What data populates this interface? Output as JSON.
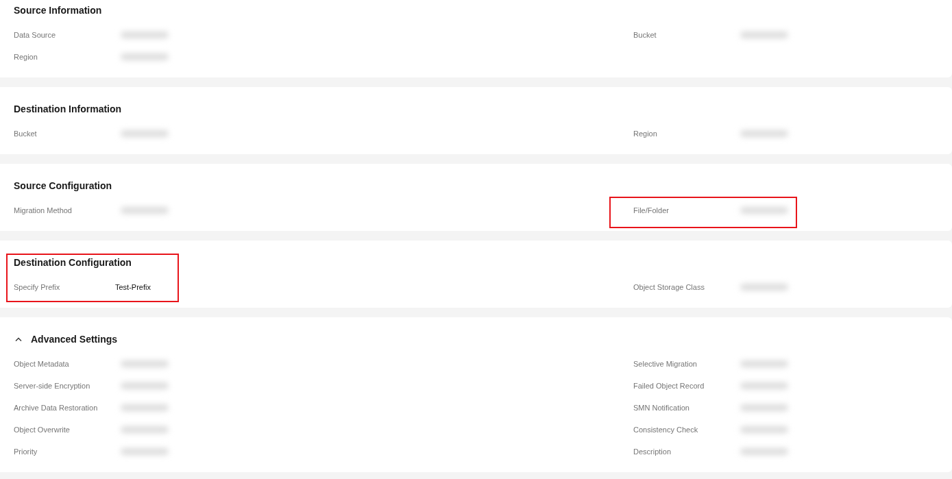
{
  "sections": [
    {
      "title": "Source Information",
      "rows": [
        [
          {
            "label": "Data Source"
          },
          {
            "label": "Bucket"
          }
        ],
        [
          {
            "label": "Region"
          }
        ]
      ]
    },
    {
      "title": "Destination Information",
      "rows": [
        [
          {
            "label": "Bucket"
          },
          {
            "label": "Region"
          }
        ]
      ]
    },
    {
      "title": "Source Configuration",
      "rows": [
        [
          {
            "label": "Migration Method"
          },
          {
            "label": "File/Folder",
            "highlighted": true
          }
        ]
      ]
    },
    {
      "title": "Destination Configuration",
      "highlighted": true,
      "rows": [
        [
          {
            "label": "Specify Prefix",
            "value": "Test-Prefix"
          },
          {
            "label": "Object Storage Class"
          }
        ]
      ]
    },
    {
      "title": "Advanced Settings",
      "expanded": true,
      "rows": [
        [
          {
            "label": "Object Metadata"
          },
          {
            "label": "Selective Migration"
          }
        ],
        [
          {
            "label": "Server-side Encryption"
          },
          {
            "label": "Failed Object Record"
          }
        ],
        [
          {
            "label": "Archive Data Restoration"
          },
          {
            "label": "SMN Notification"
          }
        ],
        [
          {
            "label": "Object Overwrite"
          },
          {
            "label": "Consistency Check"
          }
        ],
        [
          {
            "label": "Priority"
          },
          {
            "label": "Description"
          }
        ]
      ]
    }
  ]
}
